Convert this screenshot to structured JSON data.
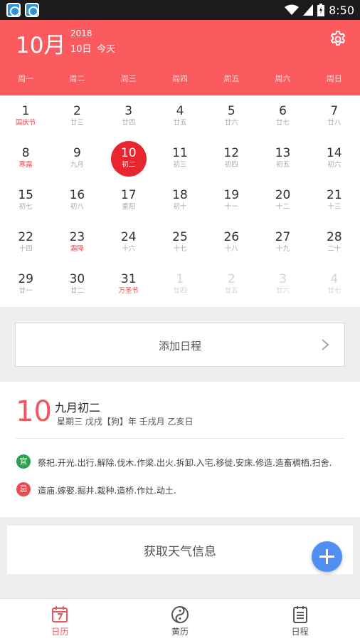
{
  "status_bar": {
    "time": "8:50"
  },
  "header": {
    "month": "10月",
    "year": "2018",
    "date": "10日",
    "today": "今天",
    "weekdays": [
      "周一",
      "周二",
      "周三",
      "周四",
      "周五",
      "周六",
      "周日"
    ]
  },
  "calendar": {
    "rows": [
      [
        {
          "d": "1",
          "s": "国庆节",
          "red": true
        },
        {
          "d": "2",
          "s": "廿三"
        },
        {
          "d": "3",
          "s": "廿四"
        },
        {
          "d": "4",
          "s": "廿五"
        },
        {
          "d": "5",
          "s": "廿六"
        },
        {
          "d": "6",
          "s": "廿七"
        },
        {
          "d": "7",
          "s": "廿八"
        }
      ],
      [
        {
          "d": "8",
          "s": "寒露",
          "red": true
        },
        {
          "d": "9",
          "s": "九月"
        },
        {
          "d": "10",
          "s": "初二",
          "selected": true
        },
        {
          "d": "11",
          "s": "初三"
        },
        {
          "d": "12",
          "s": "初四"
        },
        {
          "d": "13",
          "s": "初五"
        },
        {
          "d": "14",
          "s": "初六"
        }
      ],
      [
        {
          "d": "15",
          "s": "初七"
        },
        {
          "d": "16",
          "s": "初八"
        },
        {
          "d": "17",
          "s": "重阳"
        },
        {
          "d": "18",
          "s": "初十"
        },
        {
          "d": "19",
          "s": "十一"
        },
        {
          "d": "20",
          "s": "十二"
        },
        {
          "d": "21",
          "s": "十三"
        }
      ],
      [
        {
          "d": "22",
          "s": "十四"
        },
        {
          "d": "23",
          "s": "霜降",
          "red": true
        },
        {
          "d": "24",
          "s": "十六"
        },
        {
          "d": "25",
          "s": "十七"
        },
        {
          "d": "26",
          "s": "十八"
        },
        {
          "d": "27",
          "s": "十九"
        },
        {
          "d": "28",
          "s": "二十"
        }
      ],
      [
        {
          "d": "29",
          "s": "廿一"
        },
        {
          "d": "30",
          "s": "廿二"
        },
        {
          "d": "31",
          "s": "万圣节",
          "red": true
        },
        {
          "d": "1",
          "s": "廿四",
          "other": true
        },
        {
          "d": "2",
          "s": "廿五",
          "other": true
        },
        {
          "d": "3",
          "s": "廿六",
          "other": true
        },
        {
          "d": "4",
          "s": "廿七",
          "other": true
        }
      ]
    ]
  },
  "add_schedule": {
    "label": "添加日程"
  },
  "almanac": {
    "day": "10",
    "lunar": "九月初二",
    "ganzhi": "星期三 戊戌【狗】年 壬戌月 乙亥日",
    "yi_badge": "宜",
    "yi_text": "祭祀.开光.出行.解除.伐木.作梁.出火.拆卸.入宅.移徙.安床.修造.造畜稠栖.扫舍.",
    "ji_badge": "忌",
    "ji_text": "造庙.嫁娶.掘井.栽种.造桥.作灶.动土."
  },
  "weather": {
    "label": "获取天气信息"
  },
  "bottom_nav": {
    "calendar": "日历",
    "almanac": "黄历",
    "schedule": "日程"
  },
  "colors": {
    "accent": "#fb5a5f",
    "selected": "#e8262f",
    "fab": "#4f8ff1",
    "yi": "#2ea04f",
    "ji": "#e94b4f"
  }
}
